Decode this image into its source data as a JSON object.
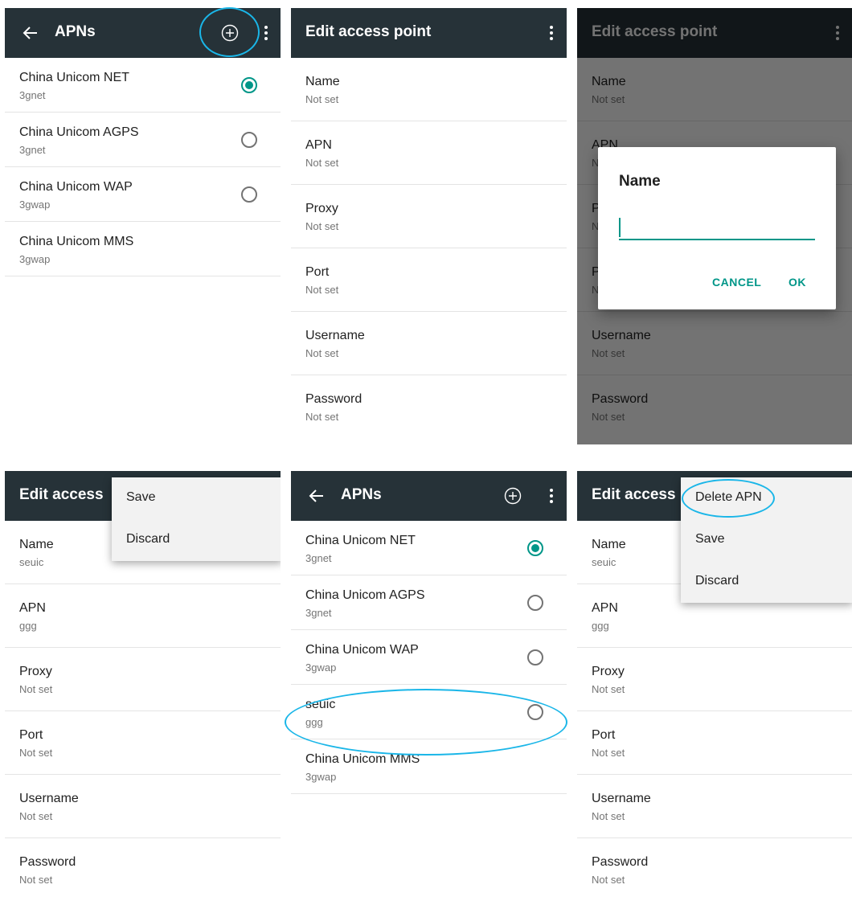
{
  "apns_screen": {
    "title": "APNs",
    "items": [
      {
        "name": "China Unicom NET",
        "apn": "3gnet",
        "selected": true
      },
      {
        "name": "China Unicom AGPS",
        "apn": "3gnet",
        "selected": false
      },
      {
        "name": "China Unicom WAP",
        "apn": "3gwap",
        "selected": false
      },
      {
        "name": "China Unicom MMS",
        "apn": "3gwap",
        "selected": false
      }
    ]
  },
  "edit_screen": {
    "title": "Edit access point",
    "title_truncated": "Edit access",
    "fields": [
      {
        "label": "Name",
        "value": "Not set"
      },
      {
        "label": "APN",
        "value": "Not set"
      },
      {
        "label": "Proxy",
        "value": "Not set"
      },
      {
        "label": "Port",
        "value": "Not set"
      },
      {
        "label": "Username",
        "value": "Not set"
      },
      {
        "label": "Password",
        "value": "Not set"
      }
    ]
  },
  "name_dialog": {
    "title": "Name",
    "input_value": "",
    "cancel_label": "CANCEL",
    "ok_label": "OK"
  },
  "edit_filled": {
    "fields": [
      {
        "label": "Name",
        "value": "seuic"
      },
      {
        "label": "APN",
        "value": "ggg"
      },
      {
        "label": "Proxy",
        "value": "Not set"
      },
      {
        "label": "Port",
        "value": "Not set"
      },
      {
        "label": "Username",
        "value": "Not set"
      },
      {
        "label": "Password",
        "value": "Not set"
      }
    ]
  },
  "save_menu": {
    "items": [
      "Save",
      "Discard"
    ]
  },
  "apns_after": {
    "title": "APNs",
    "items": [
      {
        "name": "China Unicom NET",
        "apn": "3gnet",
        "selected": true
      },
      {
        "name": "China Unicom AGPS",
        "apn": "3gnet",
        "selected": false
      },
      {
        "name": "China Unicom WAP",
        "apn": "3gwap",
        "selected": false
      },
      {
        "name": "seuic",
        "apn": "ggg",
        "selected": false
      },
      {
        "name": "China Unicom MMS",
        "apn": "3gwap",
        "selected": null
      }
    ]
  },
  "delete_menu": {
    "items": [
      "Delete APN",
      "Save",
      "Discard"
    ]
  },
  "colors": {
    "toolbar": "#263238",
    "accent": "#009688",
    "annotation": "#1ab6e8"
  },
  "icons": {
    "back": "arrow-left-icon",
    "add": "circle-plus-icon",
    "overflow": "vertical-dots-icon"
  }
}
